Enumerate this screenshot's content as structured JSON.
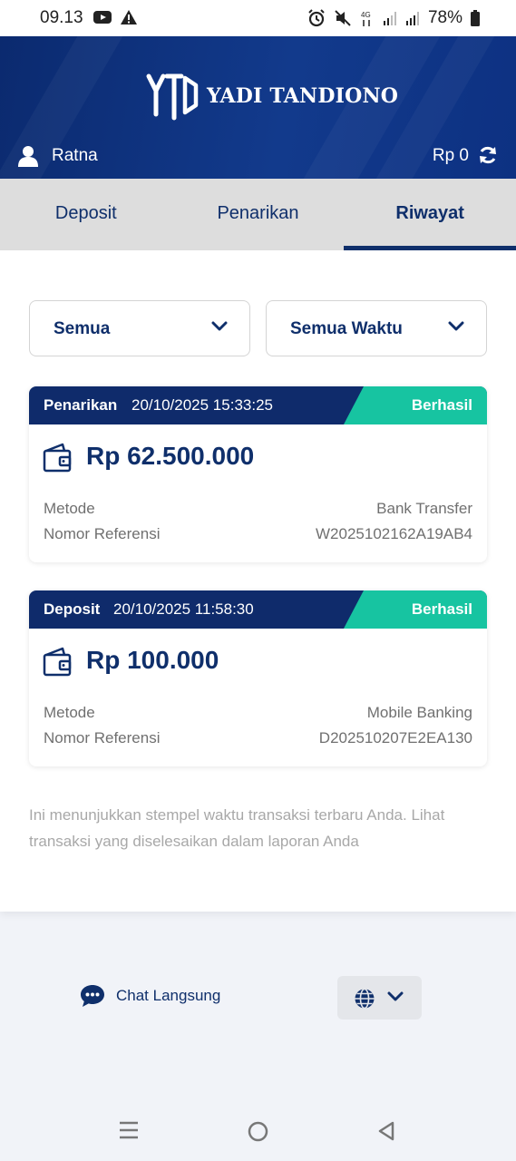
{
  "status_bar": {
    "time": "09.13",
    "battery": "78%",
    "network": "4G"
  },
  "header": {
    "brand": "YADI TANDIONO",
    "username": "Ratna",
    "balance": "Rp 0"
  },
  "tabs": [
    {
      "label": "Deposit",
      "active": false
    },
    {
      "label": "Penarikan",
      "active": false
    },
    {
      "label": "Riwayat",
      "active": true
    }
  ],
  "filters": {
    "type_selected": "Semua",
    "time_selected": "Semua Waktu"
  },
  "transactions": [
    {
      "type": "Penarikan",
      "datetime": "20/10/2025 15:33:25",
      "status": "Berhasil",
      "amount": "Rp 62.500.000",
      "method_label": "Metode",
      "method_value": "Bank Transfer",
      "ref_label": "Nomor Referensi",
      "ref_value": "W2025102162A19AB4"
    },
    {
      "type": "Deposit",
      "datetime": "20/10/2025 11:58:30",
      "status": "Berhasil",
      "amount": "Rp 100.000",
      "method_label": "Metode",
      "method_value": "Mobile Banking",
      "ref_label": "Nomor Referensi",
      "ref_value": "D202510207E2EA130"
    }
  ],
  "note": "Ini menunjukkan stempel waktu transaksi terbaru Anda. Lihat transaksi yang diselesaikan dalam laporan Anda",
  "footer": {
    "chat_label": "Chat Langsung"
  },
  "colors": {
    "primary": "#0f2f6b",
    "success": "#17c4a1",
    "header_bg": "#0b2a6f"
  }
}
